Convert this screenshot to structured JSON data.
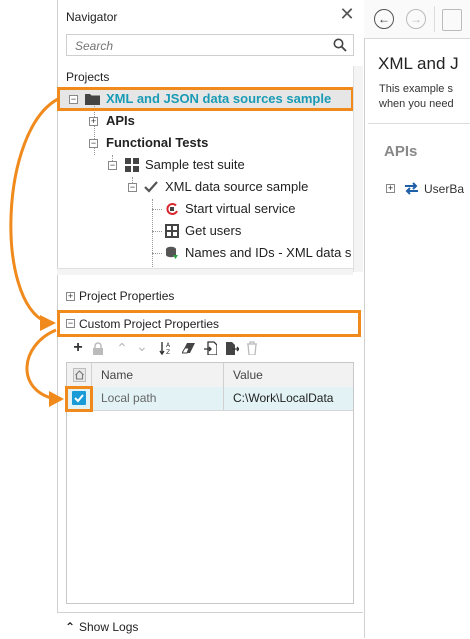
{
  "navigator": {
    "title": "Navigator",
    "close_glyph": "✕",
    "search_placeholder": "Search",
    "projects_label": "Projects",
    "tree": [
      {
        "label": "XML and JSON data sources sample",
        "icon": "folder-icon",
        "toggle": "−",
        "selected": true
      },
      {
        "label": "APIs",
        "icon": "",
        "toggle": "+",
        "bold": true
      },
      {
        "label": "Functional Tests",
        "icon": "",
        "toggle": "−",
        "bold": true
      },
      {
        "label": "Sample test suite",
        "icon": "test-suite-icon",
        "toggle": "−"
      },
      {
        "label": "XML data source sample",
        "icon": "checkmark-icon",
        "toggle": "−"
      },
      {
        "label": "Start virtual service",
        "icon": "virtual-service-icon"
      },
      {
        "label": "Get users",
        "icon": "rest-request-icon"
      },
      {
        "label": "Names and IDs - XML data s",
        "icon": "data-source-icon"
      }
    ]
  },
  "sections": {
    "project_properties": "Project Properties",
    "custom_project_properties": "Custom Project Properties",
    "plus_glyph": "+",
    "minus_glyph": "−"
  },
  "toolbar": {
    "icons": [
      "add-icon",
      "lock-icon",
      "move-up-icon",
      "move-down-icon",
      "sort-icon",
      "clear-icon",
      "import-icon",
      "export-icon",
      "delete-icon"
    ]
  },
  "table": {
    "columns": [
      "Name",
      "Value"
    ],
    "rows": [
      {
        "checked": true,
        "name": "Local path",
        "value": "C:\\Work\\LocalData"
      }
    ]
  },
  "footer": {
    "show_logs": "Show Logs",
    "chevron": "⌃"
  },
  "right_panel": {
    "title": "XML and J",
    "desc_line1": "This example s",
    "desc_line2": "when you need",
    "apis_heading": "APIs",
    "api_item": "UserBa"
  },
  "colors": {
    "highlight": "#f08a1c",
    "selected_text": "#1a9bb5",
    "row_bg": "#e2f2f5",
    "check_blue": "#1a9bd7"
  }
}
